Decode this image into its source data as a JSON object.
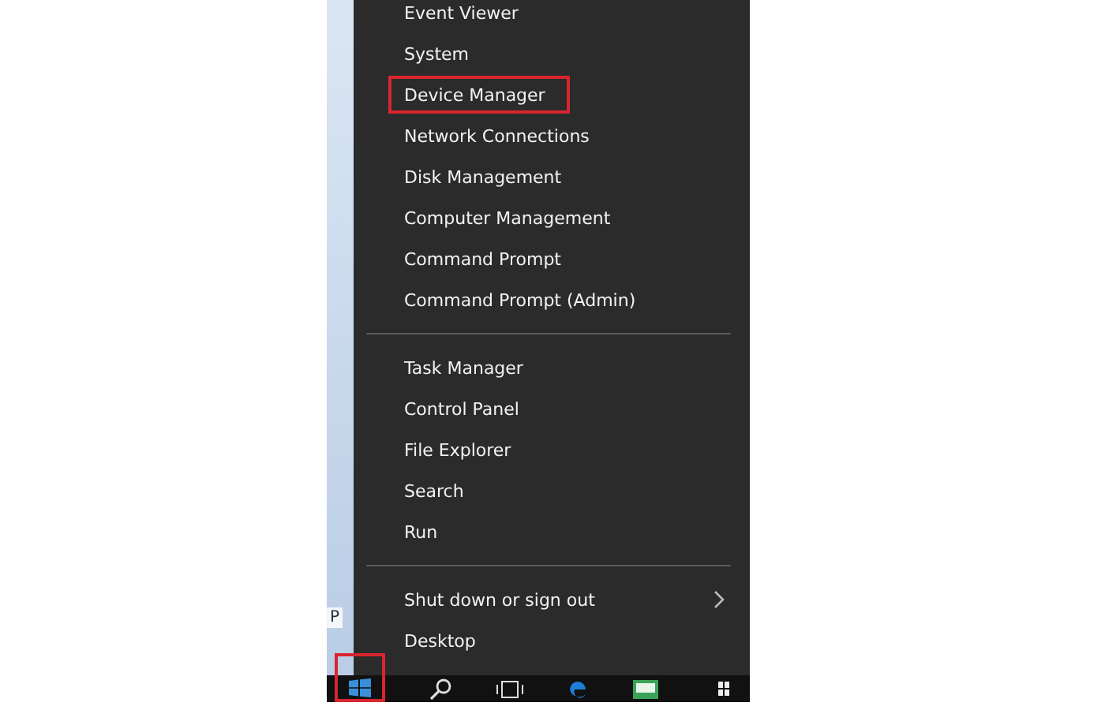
{
  "side_strip": {
    "label": "P"
  },
  "menu": {
    "groups": [
      {
        "items": [
          {
            "label": "Event Viewer",
            "highlighted": false,
            "submenu": false
          },
          {
            "label": "System",
            "highlighted": false,
            "submenu": false
          },
          {
            "label": "Device Manager",
            "highlighted": true,
            "submenu": false
          },
          {
            "label": "Network Connections",
            "highlighted": false,
            "submenu": false
          },
          {
            "label": "Disk Management",
            "highlighted": false,
            "submenu": false
          },
          {
            "label": "Computer Management",
            "highlighted": false,
            "submenu": false
          },
          {
            "label": "Command Prompt",
            "highlighted": false,
            "submenu": false
          },
          {
            "label": "Command Prompt (Admin)",
            "highlighted": false,
            "submenu": false
          }
        ]
      },
      {
        "items": [
          {
            "label": "Task Manager",
            "highlighted": false,
            "submenu": false
          },
          {
            "label": "Control Panel",
            "highlighted": false,
            "submenu": false
          },
          {
            "label": "File Explorer",
            "highlighted": false,
            "submenu": false
          },
          {
            "label": "Search",
            "highlighted": false,
            "submenu": false
          },
          {
            "label": "Run",
            "highlighted": false,
            "submenu": false
          }
        ]
      },
      {
        "items": [
          {
            "label": "Shut down or sign out",
            "highlighted": false,
            "submenu": true
          },
          {
            "label": "Desktop",
            "highlighted": false,
            "submenu": false
          }
        ]
      }
    ]
  },
  "taskbar": {
    "start_highlighted": true
  }
}
